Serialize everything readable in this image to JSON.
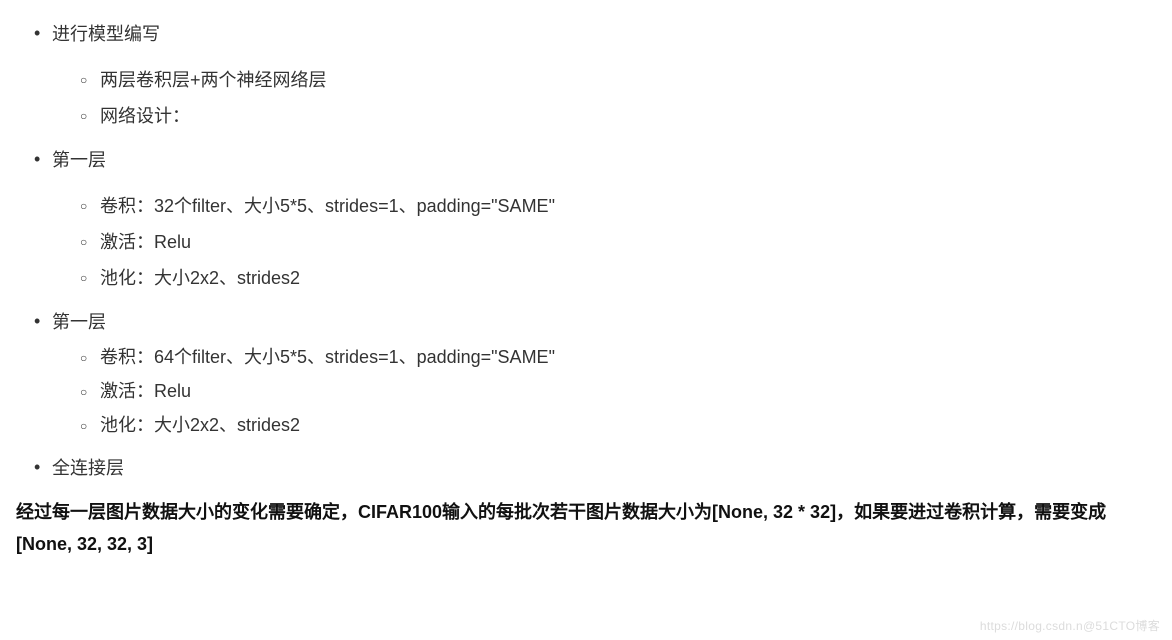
{
  "list": {
    "item1": {
      "title": "进行模型编写",
      "sub": [
        "两层卷积层+两个神经网络层",
        "网络设计："
      ]
    },
    "item2": {
      "title": "第一层",
      "sub": [
        "卷积：32个filter、大小5*5、strides=1、padding=\"SAME\"",
        "激活：Relu",
        "池化：大小2x2、strides2"
      ]
    },
    "item3": {
      "title": "第一层",
      "sub": [
        "卷积：64个filter、大小5*5、strides=1、padding=\"SAME\"",
        "激活：Relu",
        "池化：大小2x2、strides2"
      ]
    },
    "item4": {
      "title": "全连接层"
    }
  },
  "paragraph": "经过每一层图片数据大小的变化需要确定，CIFAR100输入的每批次若干图片数据大小为[None, 32 * 32]，如果要进过卷积计算，需要变成[None, 32, 32, 3]",
  "watermark": "https://blog.csdn.n@51CTO博客"
}
